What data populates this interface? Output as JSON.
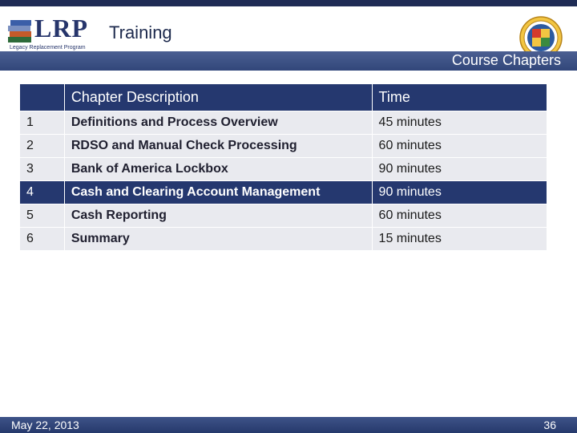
{
  "header": {
    "logo_text": "LRP",
    "logo_subtitle": "Legacy Replacement Program",
    "title": "Training"
  },
  "subbar": {
    "title": "Course Chapters"
  },
  "table": {
    "columns": [
      "",
      "Chapter Description",
      "Time"
    ],
    "rows": [
      {
        "num": "1",
        "description": "Definitions and Process Overview",
        "time": "45 minutes"
      },
      {
        "num": "2",
        "description": "RDSO and Manual Check Processing",
        "time": "60 minutes"
      },
      {
        "num": "3",
        "description": "Bank of America Lockbox",
        "time": "90 minutes"
      },
      {
        "num": "4",
        "description": "Cash and Clearing Account Management",
        "time": "90 minutes"
      },
      {
        "num": "5",
        "description": "Cash Reporting",
        "time": "60 minutes"
      },
      {
        "num": "6",
        "description": "Summary",
        "time": "15 minutes"
      }
    ],
    "highlighted_row": "4"
  },
  "footer": {
    "date": "May 22, 2013",
    "page": "36"
  },
  "colors": {
    "navy": "#25386f",
    "band": "#31467a",
    "row_bg": "#e9eaef"
  }
}
